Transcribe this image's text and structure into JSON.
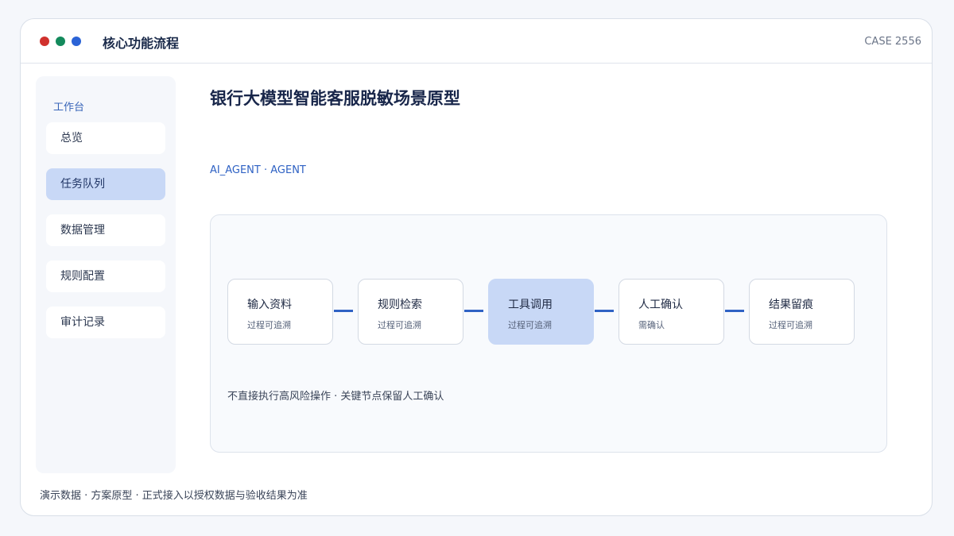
{
  "window": {
    "title": "核心功能流程",
    "case_id": "CASE 2556",
    "controls": [
      "red-dot",
      "green-dot",
      "blue-dot"
    ]
  },
  "sidebar": {
    "heading": "工作台",
    "items": [
      {
        "label": "总览",
        "active": false
      },
      {
        "label": "任务队列",
        "active": true
      },
      {
        "label": "数据管理",
        "active": false
      },
      {
        "label": "规则配置",
        "active": false
      },
      {
        "label": "审计记录",
        "active": false
      }
    ]
  },
  "main": {
    "title": "银行大模型智能客服脱敏场景原型",
    "tags": "AI_AGENT · AGENT",
    "flow": {
      "steps": [
        {
          "title": "输入资料",
          "subtitle": "过程可追溯",
          "active": false
        },
        {
          "title": "规则检索",
          "subtitle": "过程可追溯",
          "active": false
        },
        {
          "title": "工具调用",
          "subtitle": "过程可追溯",
          "active": true
        },
        {
          "title": "人工确认",
          "subtitle": "需确认",
          "active": false
        },
        {
          "title": "结果留痕",
          "subtitle": "过程可追溯",
          "active": false
        }
      ],
      "note": "不直接执行高风险操作 · 关键节点保留人工确认"
    }
  },
  "footer": {
    "note": "演示数据 · 方案原型 · 正式接入以授权数据与验收结果为准"
  },
  "colors": {
    "accent": "#2f62c4",
    "active_fill": "#c8d8f6",
    "dot_red": "#d0312d",
    "dot_green": "#138a5c",
    "dot_blue": "#2b63d6"
  }
}
